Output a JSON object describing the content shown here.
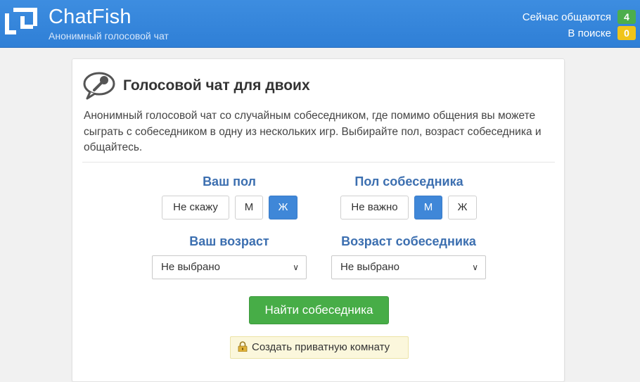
{
  "header": {
    "brand": "ChatFish",
    "tagline": "Анонимный голосовой чат",
    "stats": [
      {
        "label": "Сейчас общаются",
        "value": "4",
        "color": "#4cae4c"
      },
      {
        "label": "В поиске",
        "value": "0",
        "color": "#f0c419"
      }
    ]
  },
  "card": {
    "title": "Голосовой чат для двоих",
    "description": "Анонимный голосовой чат со случайным собеседником, где помимо общения вы можете сыграть с собеседником в одну из нескольких игр. Выбирайте пол, возраст собеседника и общайтесь."
  },
  "my_gender": {
    "label": "Ваш пол",
    "options": [
      "Не скажу",
      "М",
      "Ж"
    ],
    "selected": "Ж"
  },
  "partner_gender": {
    "label": "Пол собеседника",
    "options": [
      "Не важно",
      "М",
      "Ж"
    ],
    "selected": "М"
  },
  "my_age": {
    "label": "Ваш возраст",
    "value": "Не выбрано"
  },
  "partner_age": {
    "label": "Возраст собеседника",
    "value": "Не выбрано"
  },
  "actions": {
    "find": "Найти собеседника",
    "private": "Создать приватную комнату"
  },
  "icons": {
    "logo": "chatfish-logo-icon",
    "mic": "microphone-chat-icon",
    "lock": "lock-icon",
    "arrow": "chevron-down-icon"
  },
  "colors": {
    "header": "#3d8de0",
    "accent": "#3f87d8",
    "label": "#3c6fb0",
    "find_button": "#47ad47",
    "private_button": "#fbf7dc"
  }
}
